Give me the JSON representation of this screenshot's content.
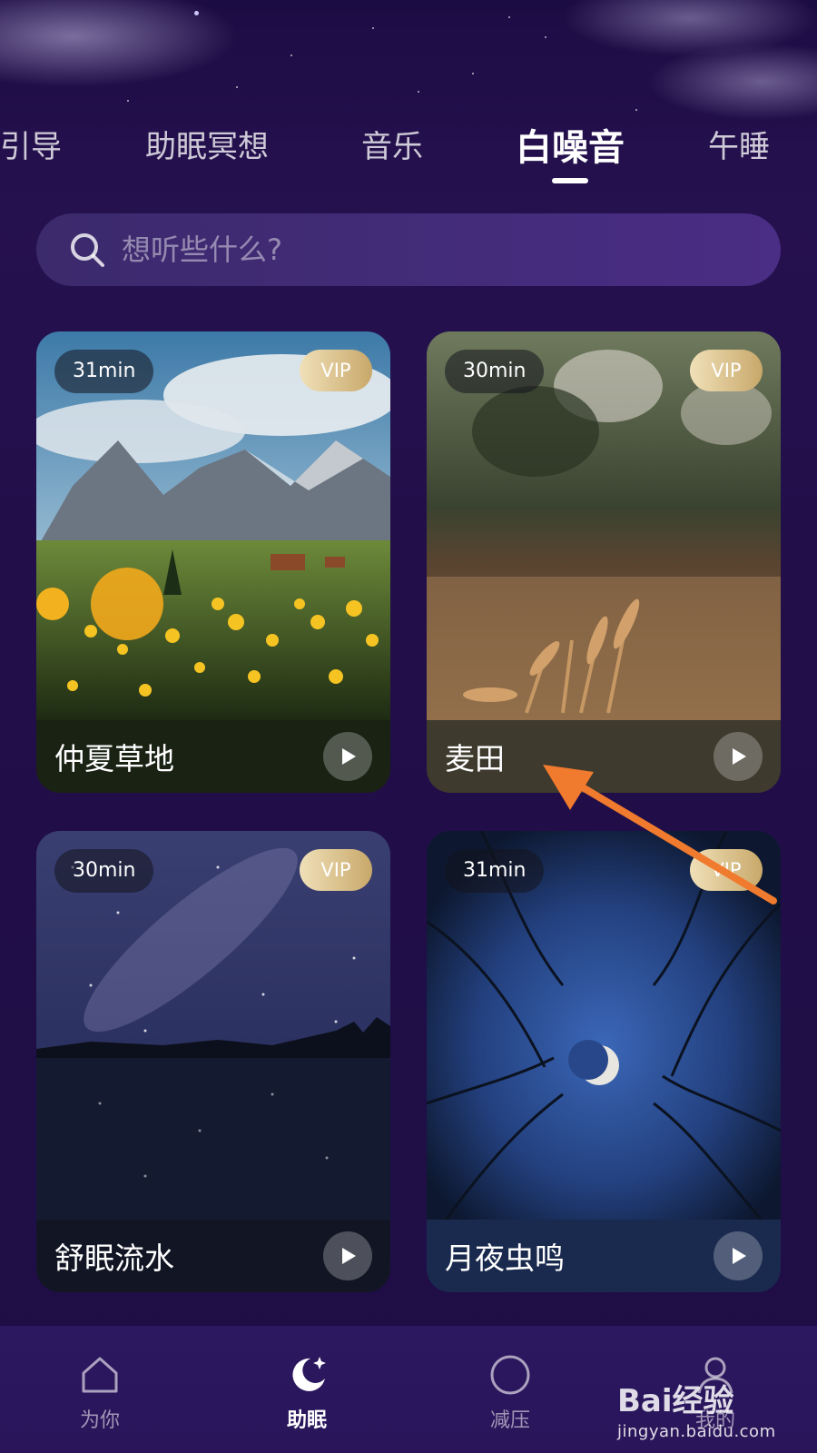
{
  "tabs": [
    {
      "label": "引导",
      "active": false
    },
    {
      "label": "助眠冥想",
      "active": false
    },
    {
      "label": "音乐",
      "active": false
    },
    {
      "label": "白噪音",
      "active": true
    },
    {
      "label": "午睡",
      "active": false
    }
  ],
  "search": {
    "placeholder": "想听些什么?"
  },
  "cards": [
    {
      "title": "仲夏草地",
      "duration": "31min",
      "badge": "VIP",
      "scene": "meadow"
    },
    {
      "title": "麦田",
      "duration": "30min",
      "badge": "VIP",
      "scene": "wheat-field"
    },
    {
      "title": "舒眠流水",
      "duration": "30min",
      "badge": "VIP",
      "scene": "starry-lake"
    },
    {
      "title": "月夜虫鸣",
      "duration": "31min",
      "badge": "VIP",
      "scene": "moon-forest"
    }
  ],
  "bottom_nav": [
    {
      "label": "为你",
      "icon": "home-icon",
      "active": false
    },
    {
      "label": "助眠",
      "icon": "moon-icon",
      "active": true
    },
    {
      "label": "减压",
      "icon": "circle-icon",
      "active": false
    },
    {
      "label": "我的",
      "icon": "profile-icon",
      "active": false
    }
  ],
  "watermark": {
    "main": "Bai经验",
    "sub": "jingyan.baidu.com"
  },
  "colors": {
    "background": "#22104a",
    "accent": "#ffffff",
    "vip": "#d8bc82",
    "annotation_arrow": "#f07a2e"
  }
}
